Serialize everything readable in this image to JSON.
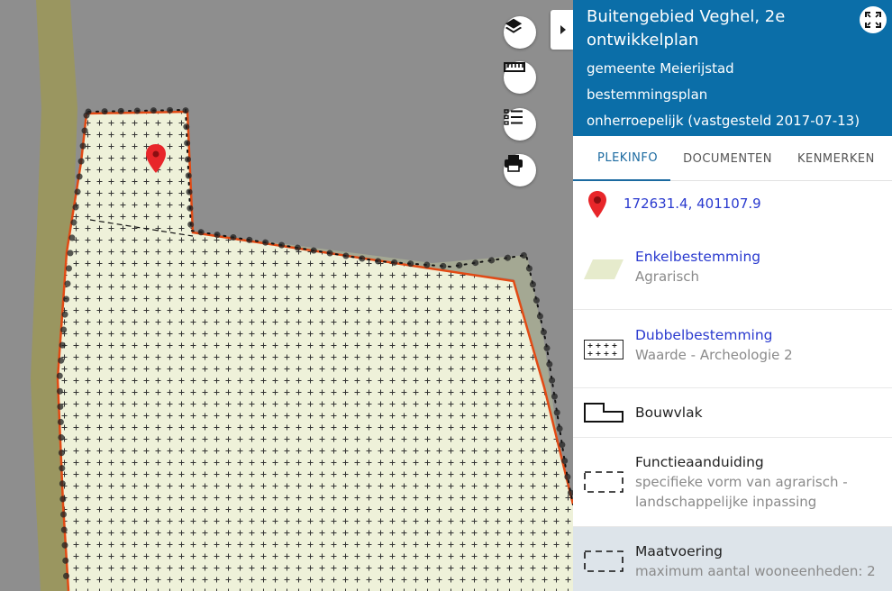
{
  "map_controls": {
    "layers_icon": "layers-icon",
    "ruler_icon": "ruler-icon",
    "legend_icon": "list-icon",
    "print_icon": "printer-icon",
    "collapse_icon": "chevron-right-icon"
  },
  "panel": {
    "title": "Buitengebied Veghel, 2e ontwikkelplan",
    "municipality": "gemeente Meierijstad",
    "plan_type": "bestemmingsplan",
    "status": "onherroepelijk (vastgesteld 2017-07-13)",
    "fullscreen_icon": "fullscreen-icon"
  },
  "tabs": [
    {
      "label": "PLEKINFO",
      "active": true
    },
    {
      "label": "DOCUMENTEN",
      "active": false
    },
    {
      "label": "KENMERKEN",
      "active": false
    }
  ],
  "location": {
    "coordinates": "172631.4, 401107.9",
    "marker_color": "#e8262a"
  },
  "items": [
    {
      "title": "Enkelbestemming",
      "subtitle": "Agrarisch",
      "link": true
    },
    {
      "title": "Dubbelbestemming",
      "subtitle": "Waarde - Archeologie 2",
      "link": true
    },
    {
      "title": "Bouwvlak",
      "subtitle": "",
      "link": false
    },
    {
      "title": "Functieaanduiding",
      "subtitle": "specifieke vorm van agrarisch - landschappelijke inpassing",
      "link": false
    },
    {
      "title": "Maatvoering",
      "subtitle": "maximum aantal wooneenheden: 2",
      "link": false
    }
  ],
  "colors": {
    "header_bg": "#0b6ea8",
    "link": "#2a3acf",
    "agrarisch_fill": "#eef1d9",
    "boundary": "#e24a14",
    "road": "#9a9660",
    "highlight_row": "#dde4ea"
  }
}
